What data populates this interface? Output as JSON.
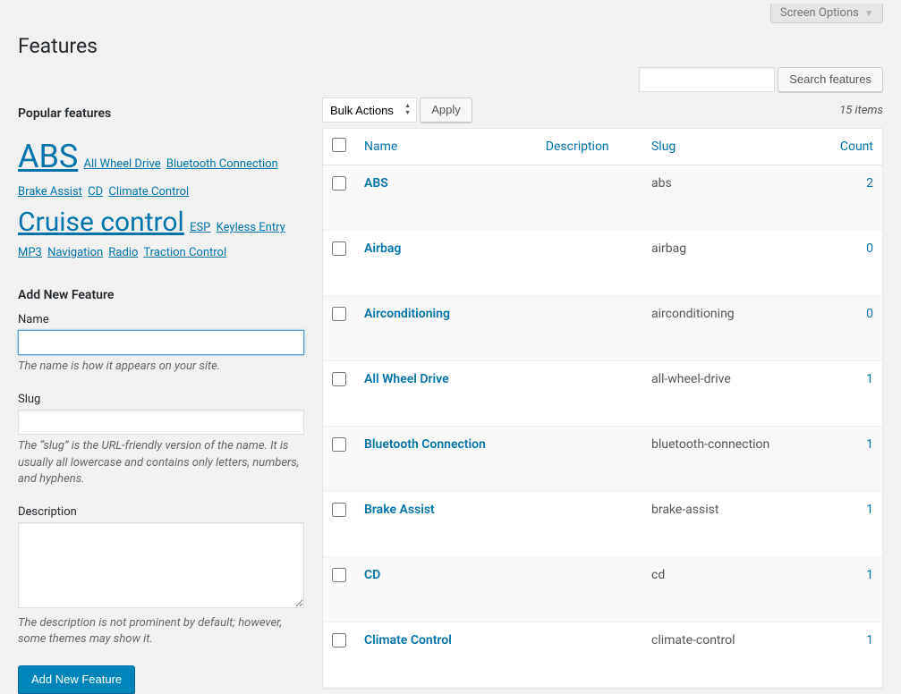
{
  "screen_options_label": "Screen Options",
  "page_title": "Features",
  "search": {
    "value": "",
    "button": "Search features"
  },
  "popular": {
    "heading": "Popular features",
    "tags": [
      {
        "label": "ABS",
        "size": 36
      },
      {
        "label": "All Wheel Drive",
        "size": 13
      },
      {
        "label": "Bluetooth Connection",
        "size": 13
      },
      {
        "label": "Brake Assist",
        "size": 13
      },
      {
        "label": "CD",
        "size": 13
      },
      {
        "label": "Climate Control",
        "size": 13
      },
      {
        "label": "Cruise control",
        "size": 30
      },
      {
        "label": "ESP",
        "size": 13
      },
      {
        "label": "Keyless Entry",
        "size": 13
      },
      {
        "label": "MP3",
        "size": 13
      },
      {
        "label": "Navigation",
        "size": 13
      },
      {
        "label": "Radio",
        "size": 13
      },
      {
        "label": "Traction Control",
        "size": 13
      }
    ]
  },
  "add_new": {
    "heading": "Add New Feature",
    "name_label": "Name",
    "name_value": "",
    "name_hint": "The name is how it appears on your site.",
    "slug_label": "Slug",
    "slug_value": "",
    "slug_hint": "The “slug” is the URL-friendly version of the name. It is usually all lowercase and contains only letters, numbers, and hyphens.",
    "desc_label": "Description",
    "desc_value": "",
    "desc_hint": "The description is not prominent by default; however, some themes may show it.",
    "submit": "Add New Feature"
  },
  "list": {
    "bulk_action_selected": "Bulk Actions",
    "apply_label": "Apply",
    "item_count": "15 items",
    "columns": {
      "name": "Name",
      "description": "Description",
      "slug": "Slug",
      "count": "Count"
    },
    "rows": [
      {
        "name": "ABS",
        "description": "",
        "slug": "abs",
        "count": "2"
      },
      {
        "name": "Airbag",
        "description": "",
        "slug": "airbag",
        "count": "0"
      },
      {
        "name": "Airconditioning",
        "description": "",
        "slug": "airconditioning",
        "count": "0"
      },
      {
        "name": "All Wheel Drive",
        "description": "",
        "slug": "all-wheel-drive",
        "count": "1"
      },
      {
        "name": "Bluetooth Connection",
        "description": "",
        "slug": "bluetooth-connection",
        "count": "1"
      },
      {
        "name": "Brake Assist",
        "description": "",
        "slug": "brake-assist",
        "count": "1"
      },
      {
        "name": "CD",
        "description": "",
        "slug": "cd",
        "count": "1"
      },
      {
        "name": "Climate Control",
        "description": "",
        "slug": "climate-control",
        "count": "1"
      }
    ]
  }
}
